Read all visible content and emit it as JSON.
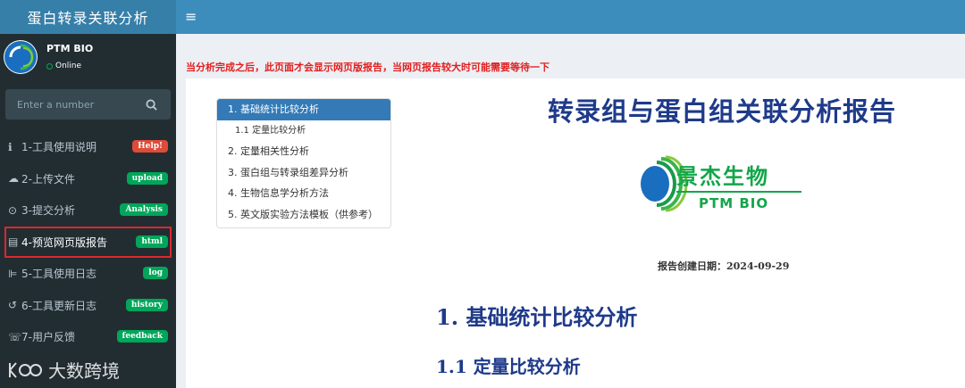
{
  "app": {
    "title": "蛋白转录关联分析"
  },
  "topbar": {
    "menu_icon": "hamburger-icon"
  },
  "user": {
    "name": "PTM BIO",
    "status": "Online"
  },
  "search": {
    "placeholder": "Enter a number",
    "icon": "search-icon"
  },
  "sidebar": {
    "items": [
      {
        "icon": "info-circle-icon",
        "label": "1-工具使用说明",
        "badge": "Help!",
        "badge_color": "#dd4b39"
      },
      {
        "icon": "cloud-upload-icon",
        "label": "2-上传文件",
        "badge": "upload",
        "badge_color": "#00a65a"
      },
      {
        "icon": "play-circle-icon",
        "label": "3-提交分析",
        "badge": "Analysis",
        "badge_color": "#00a65a"
      },
      {
        "icon": "file-icon",
        "label": "4-预览网页版报告",
        "badge": "html",
        "badge_color": "#00a65a"
      },
      {
        "icon": "chart-icon",
        "label": "5-工具使用日志",
        "badge": "log",
        "badge_color": "#00a65a"
      },
      {
        "icon": "history-icon",
        "label": "6-工具更新日志",
        "badge": "history",
        "badge_color": "#00a65a"
      },
      {
        "icon": "comments-icon",
        "label": "7-用户反馈",
        "badge": "feedback",
        "badge_color": "#00a65a"
      }
    ],
    "active_index": 3
  },
  "watermark": {
    "text": "大数跨境"
  },
  "notice": "当分析完成之后，此页面才会显示网页版报告，当网页报告较大时可能需要等待一下",
  "report": {
    "toc": [
      {
        "label": "1. 基础统计比较分析",
        "selected": true
      },
      {
        "label": "1.1 定量比较分析",
        "sub": true
      },
      {
        "label": "2. 定量相关性分析"
      },
      {
        "label": "3. 蛋白组与转录组差异分析"
      },
      {
        "label": "4. 生物信息学分析方法"
      },
      {
        "label": "5. 英文版实验方法模板（供参考）"
      }
    ],
    "title": "转录组与蛋白组关联分析报告",
    "logo_cn": "景杰生物",
    "logo_en": "PTM BIO",
    "date": "报告创建日期：2024-09-29",
    "h1": "1. 基础统计比较分析",
    "h2": "1.1 定量比较分析"
  },
  "colors": {
    "header": "#3c8dbc",
    "brand": "#367fa9",
    "sidebar": "#222d32",
    "active_outline": "#d9292e",
    "heading": "#1e3a8a",
    "logo_green": "#12a64a"
  }
}
